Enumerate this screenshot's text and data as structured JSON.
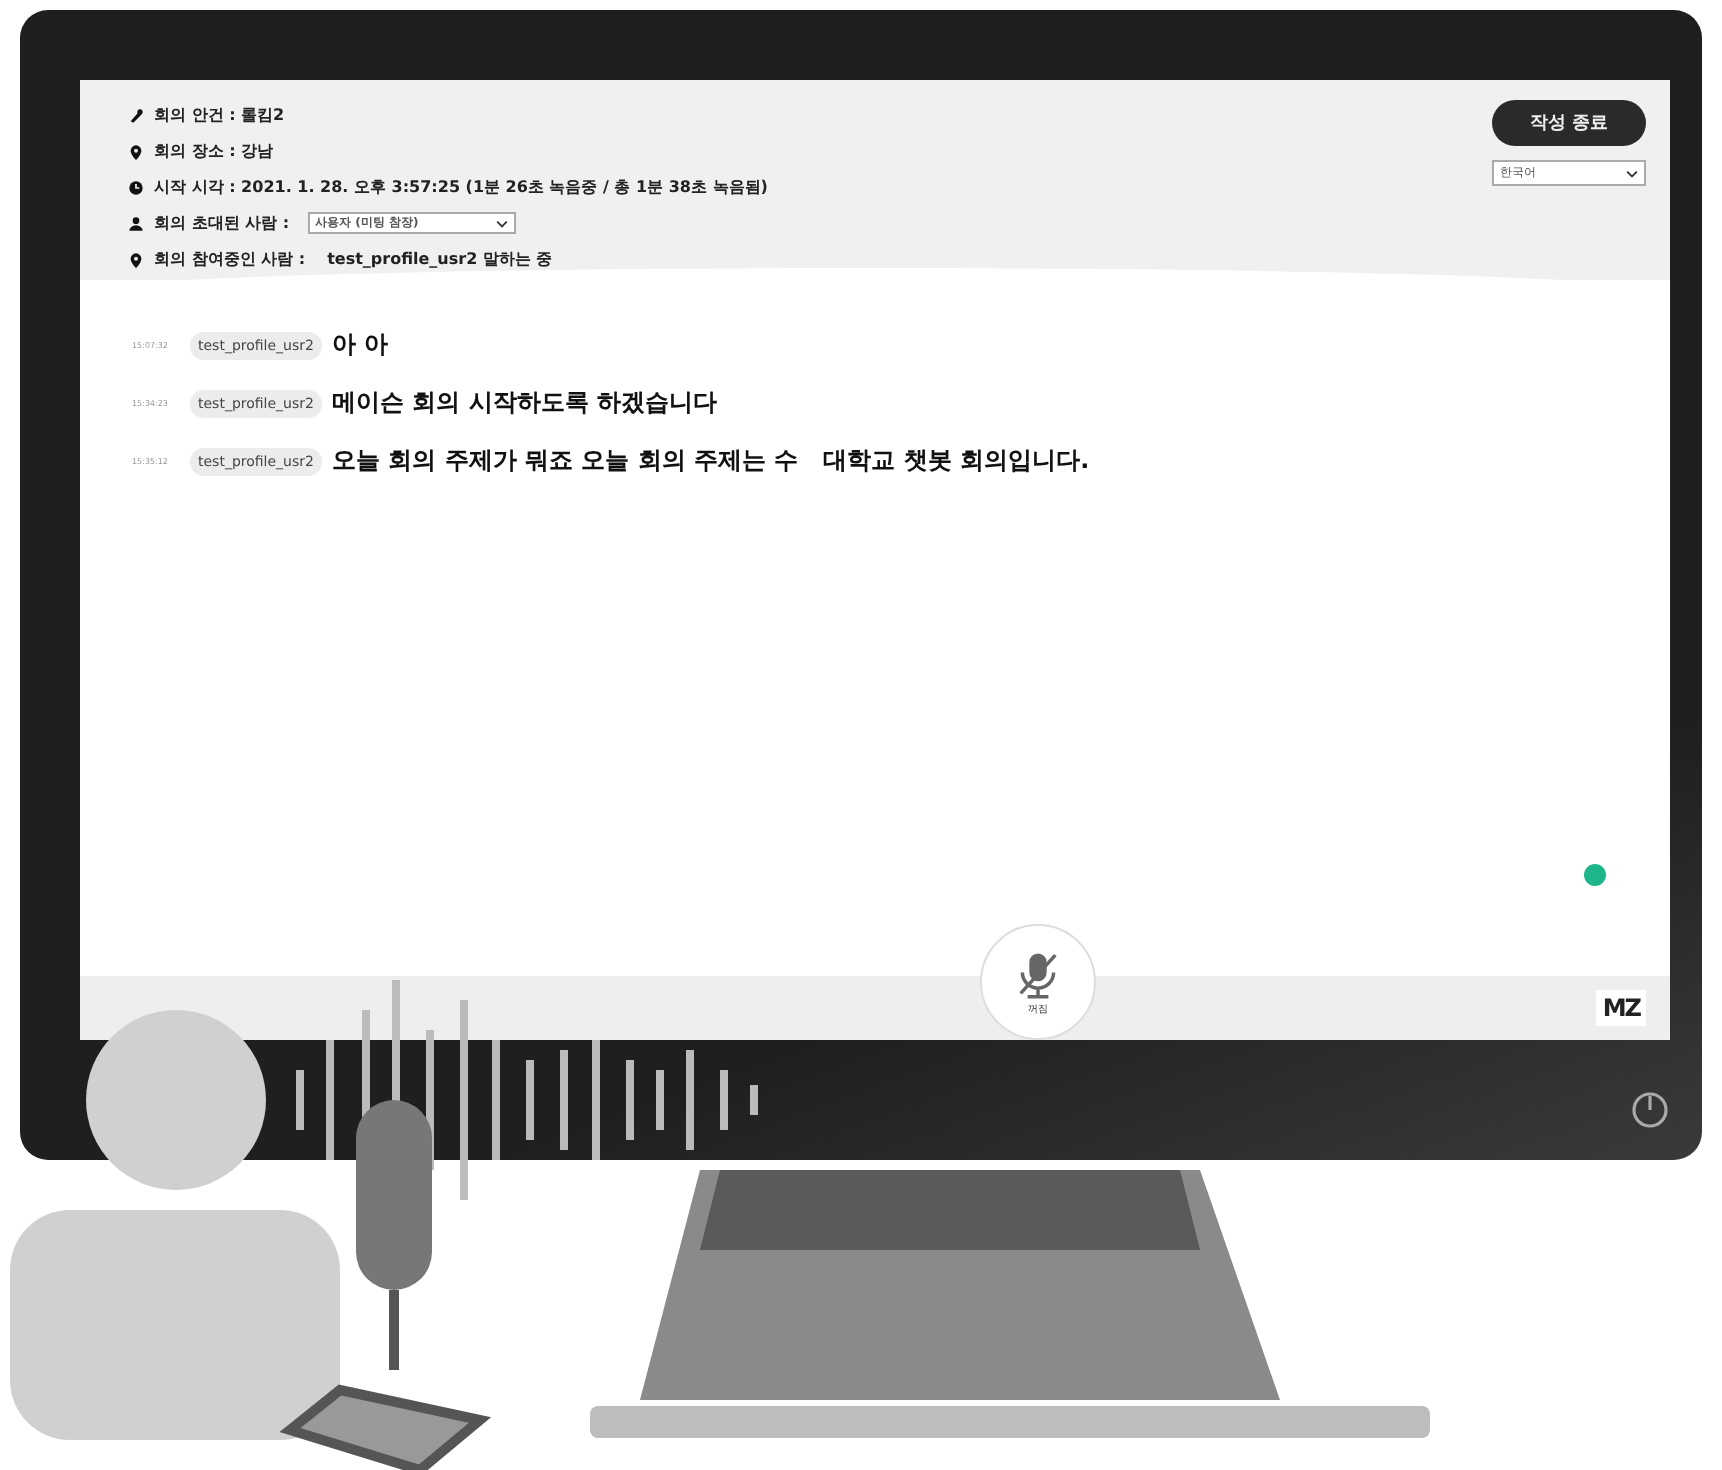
{
  "header": {
    "fields": [
      {
        "kind": "text",
        "label": "회의 안건 : 롤킴2"
      },
      {
        "kind": "text",
        "label": "회의 장소 : 강남"
      },
      {
        "kind": "text",
        "label": "시작 시각 : 2021. 1. 28. 오후 3:57:25 (1분 26초 녹음중 / 총 1분 38초 녹음됨)"
      },
      {
        "kind": "select",
        "label": "회의 초대된 사람 :",
        "value": "사용자 (미팅 참장)"
      },
      {
        "kind": "text",
        "label": "회의 참여중인 사람 :",
        "value": "test_profile_usr2 말하는 중"
      }
    ],
    "end_button": "작성 종료",
    "language": "한국어"
  },
  "messages": [
    {
      "time": "15:07:32",
      "speaker": "test_profile_usr2",
      "text": "아 아"
    },
    {
      "time": "15:34:23",
      "speaker": "test_profile_usr2",
      "text": "메이슨 회의 시작하도록 하겠습니다"
    },
    {
      "time": "15:35:12",
      "speaker": "test_profile_usr2",
      "text": "오늘 회의 주제가 뭐죠 오늘 회의 주제는 수   대학교 챗봇 회의입니다."
    }
  ],
  "mic": {
    "label": "꺼짐",
    "muted": true
  },
  "logo": "MZ"
}
